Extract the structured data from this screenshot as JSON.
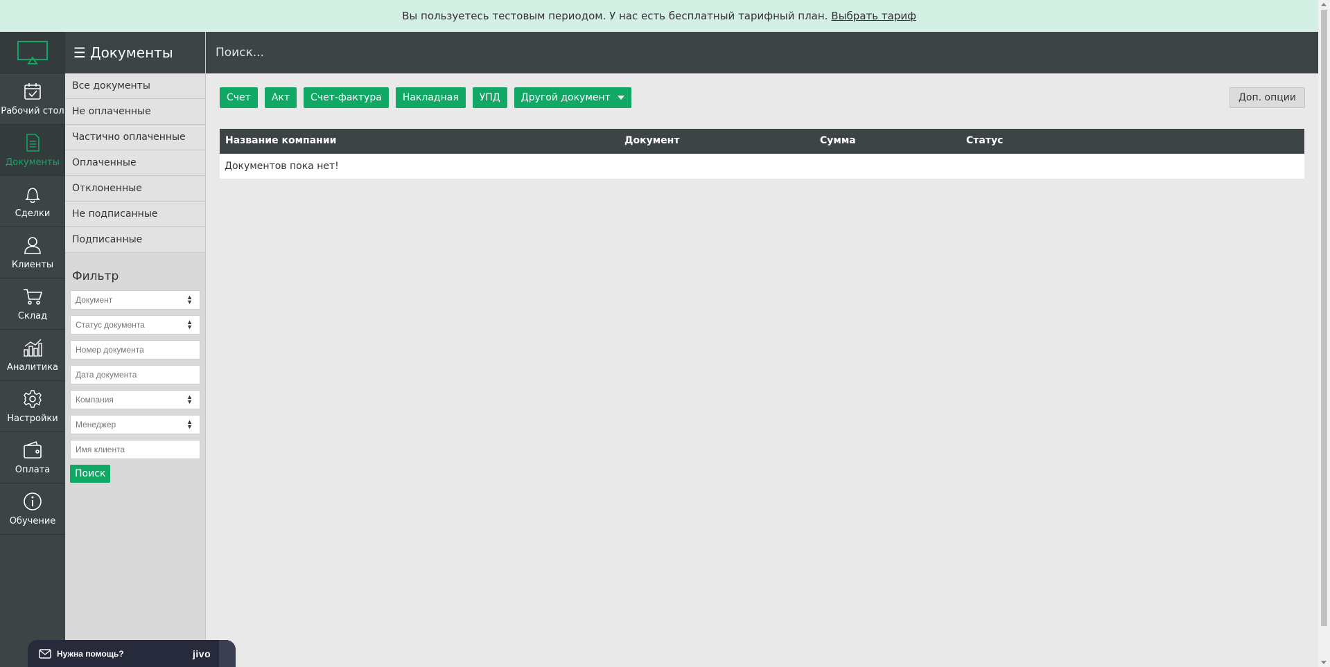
{
  "banner": {
    "text": "Вы пользуетесь тестовым периодом. У нас есть бесплатный тарифный план.",
    "link": "Выбрать тариф"
  },
  "rail": {
    "items": [
      {
        "label": "Рабочий стол",
        "icon": "calendar-icon"
      },
      {
        "label": "Документы",
        "icon": "document-icon",
        "active": true
      },
      {
        "label": "Сделки",
        "icon": "bell-icon"
      },
      {
        "label": "Клиенты",
        "icon": "users-icon"
      },
      {
        "label": "Склад",
        "icon": "cart-icon"
      },
      {
        "label": "Аналитика",
        "icon": "chart-icon"
      },
      {
        "label": "Настройки",
        "icon": "gear-icon"
      },
      {
        "label": "Оплата",
        "icon": "wallet-icon"
      },
      {
        "label": "Обучение",
        "icon": "info-icon"
      }
    ]
  },
  "subnav": {
    "title": "Документы",
    "items": [
      "Все документы",
      "Не оплаченные",
      "Частично оплаченные",
      "Оплаченные",
      "Отклоненные",
      "Не подписанные",
      "Подписанные"
    ]
  },
  "filter": {
    "title": "Фильтр",
    "document": "Документ",
    "status": "Статус документа",
    "number": "Номер документа",
    "date": "Дата документа",
    "company": "Компания",
    "manager": "Менеджер",
    "client": "Имя клиента",
    "submit": "Поиск"
  },
  "search": {
    "placeholder": "Поиск..."
  },
  "actions": {
    "buttons": [
      "Счет",
      "Акт",
      "Счет-фактура",
      "Накладная",
      "УПД"
    ],
    "other": "Другой документ",
    "options": "Доп. опции"
  },
  "table": {
    "headers": [
      "Название компании",
      "Документ",
      "Сумма",
      "Статус"
    ],
    "empty": "Документов пока нет!"
  },
  "help": {
    "label": "Нужна помощь?",
    "brand": "jivo"
  },
  "colors": {
    "accent": "#11a765",
    "dark": "#3d4446",
    "banner": "#d4f0e4"
  }
}
